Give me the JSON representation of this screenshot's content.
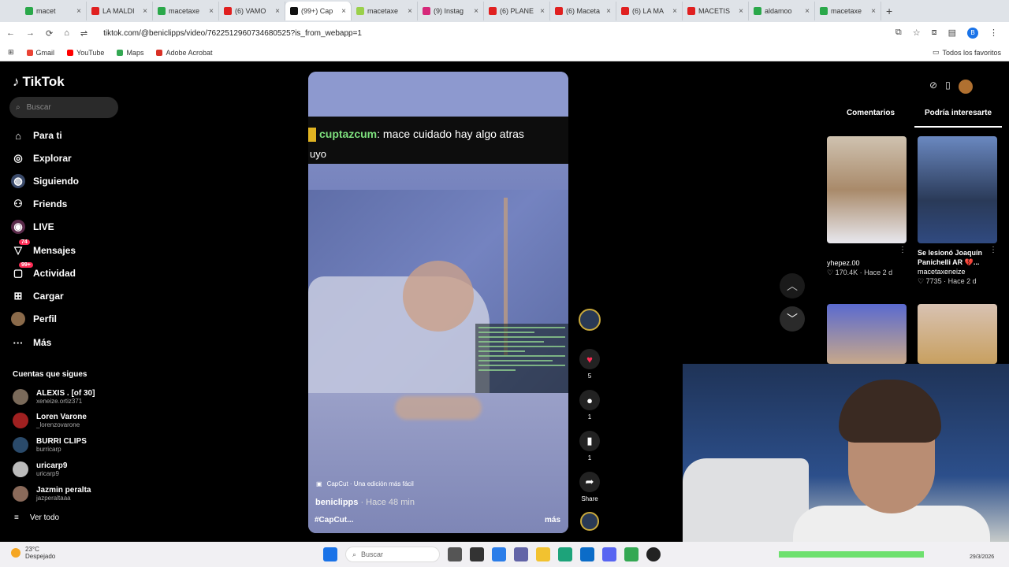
{
  "browser": {
    "tabs": [
      {
        "label": "macet",
        "color": "#2aa84a"
      },
      {
        "label": "LA MALDI",
        "color": "#e02020"
      },
      {
        "label": "macetaxe",
        "color": "#2aa84a"
      },
      {
        "label": "(6) VAMO",
        "color": "#e02020"
      },
      {
        "label": "(99+) Cap",
        "color": "#111111",
        "active": true
      },
      {
        "label": "macetaxe",
        "color": "#9ad04a"
      },
      {
        "label": "(9) Instag",
        "color": "#d6287a"
      },
      {
        "label": "(6) PLANE",
        "color": "#e02020"
      },
      {
        "label": "(6) Maceta",
        "color": "#e02020"
      },
      {
        "label": "(6) LA MA",
        "color": "#e02020"
      },
      {
        "label": "MACETIS",
        "color": "#e02020"
      },
      {
        "label": "aldamoo",
        "color": "#2aa84a"
      },
      {
        "label": "macetaxe",
        "color": "#2aa84a"
      }
    ],
    "url": "tiktok.com/@beniclipps/video/7622512960734680525?is_from_webapp=1",
    "bookmarks": [
      "Gmail",
      "YouTube",
      "Maps",
      "Adobe Acrobat"
    ],
    "all_bookmarks": "Todos los favoritos"
  },
  "sidebar": {
    "logo": "TikTok",
    "search_placeholder": "Buscar",
    "nav": [
      "Para ti",
      "Explorar",
      "Siguiendo",
      "Friends",
      "LIVE",
      "Mensajes",
      "Actividad",
      "Cargar",
      "Perfil",
      "Más"
    ],
    "badges": {
      "mensajes": "74",
      "actividad": "99+"
    },
    "following_title": "Cuentas que sigues",
    "following": [
      {
        "name": "ALEXIS . [of 30]",
        "handle": "xeneize.ortiz371"
      },
      {
        "name": "Loren Varone",
        "handle": "_lorenzovarone"
      },
      {
        "name": "BURRI CLIPS",
        "handle": "burricarp"
      },
      {
        "name": "uricarp9",
        "handle": "uricarp9"
      },
      {
        "name": "Jazmin peralta",
        "handle": "jazperaltaaa"
      }
    ],
    "see_all": "Ver todo"
  },
  "video": {
    "chat_user": "cuptazcum",
    "chat_text": ": mace cuidado hay algo atras",
    "chat_text2": "uyo",
    "capcut": "CapCut · Una edición más fácil",
    "author": "beniclipps",
    "time": " · Hace 48 min",
    "hashtag": "#CapCut...",
    "more": "más"
  },
  "actions": {
    "likes": "5",
    "comments": "1",
    "saves": "1",
    "share": "Share"
  },
  "right": {
    "tabs": [
      "Comentarios",
      "Podría interesarte"
    ],
    "cards": [
      {
        "user": "yhepez.00",
        "stats": "♡ 170.4K · Hace 2 d"
      },
      {
        "title": "Se lesionó Joaquín Panichelli AR 💔...",
        "user": "macetaxeneize",
        "stats": "♡ 7735 · Hace 2 d"
      }
    ]
  },
  "taskbar": {
    "temp": "23°C",
    "weather": "Despejado",
    "search": "Buscar",
    "date": "29/3/2026"
  }
}
